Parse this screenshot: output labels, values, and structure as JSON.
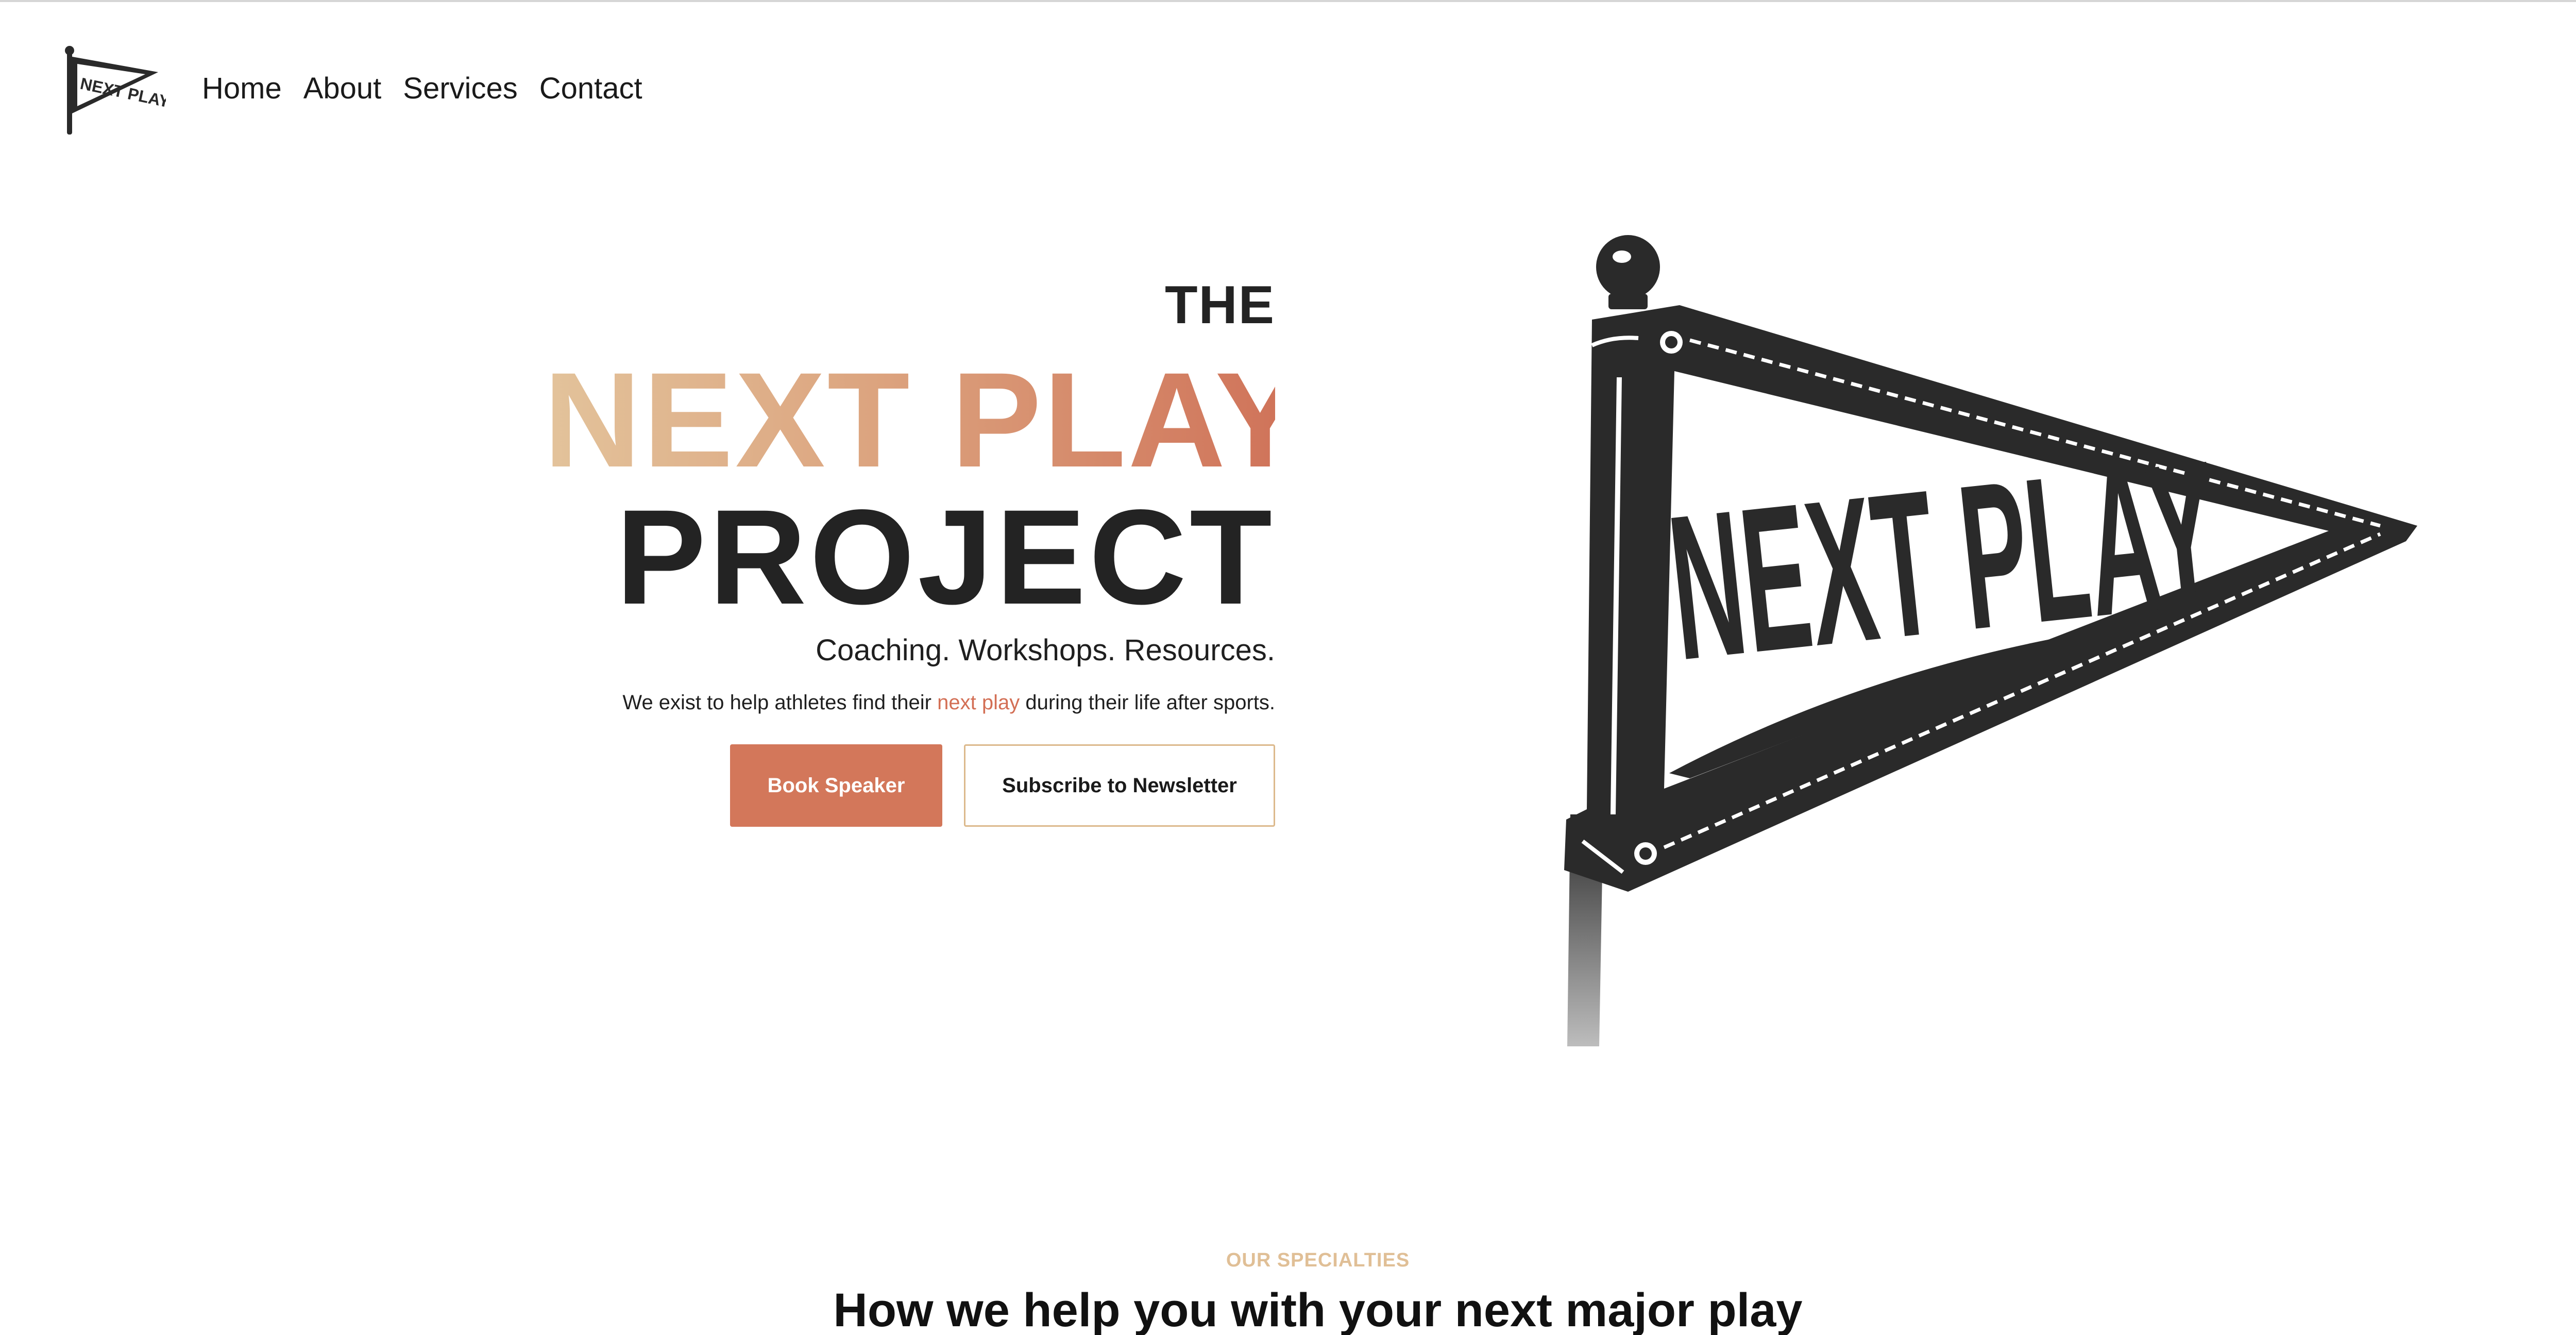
{
  "brand": {
    "logo_text": "NEXT PLAY",
    "accent_color": "#d3775a",
    "gradient_colors": [
      "#e3c39b",
      "#dca47f",
      "#d0745a"
    ],
    "outline_color": "#dcb98c"
  },
  "nav": {
    "items": [
      {
        "label": "Home"
      },
      {
        "label": "About"
      },
      {
        "label": "Services"
      },
      {
        "label": "Contact"
      }
    ]
  },
  "hero": {
    "the": "THE",
    "next_play": "NEXT PLAY",
    "project": "PROJECT",
    "tagline": "Coaching. Workshops. Resources.",
    "mission_before": "We exist to help athletes find their ",
    "mission_accent": "next play",
    "mission_after": " during their life after sports.",
    "primary_button": "Book Speaker",
    "secondary_button": "Subscribe to Newsletter"
  },
  "illustration": {
    "flag_text": "NEXT PLAY",
    "icon": "pennant-flag-icon"
  },
  "side_widget": {
    "icon": "settings-list-icon"
  },
  "specialties": {
    "eyebrow": "OUR SPECIALTIES",
    "title": "How we help you with your next major play"
  }
}
